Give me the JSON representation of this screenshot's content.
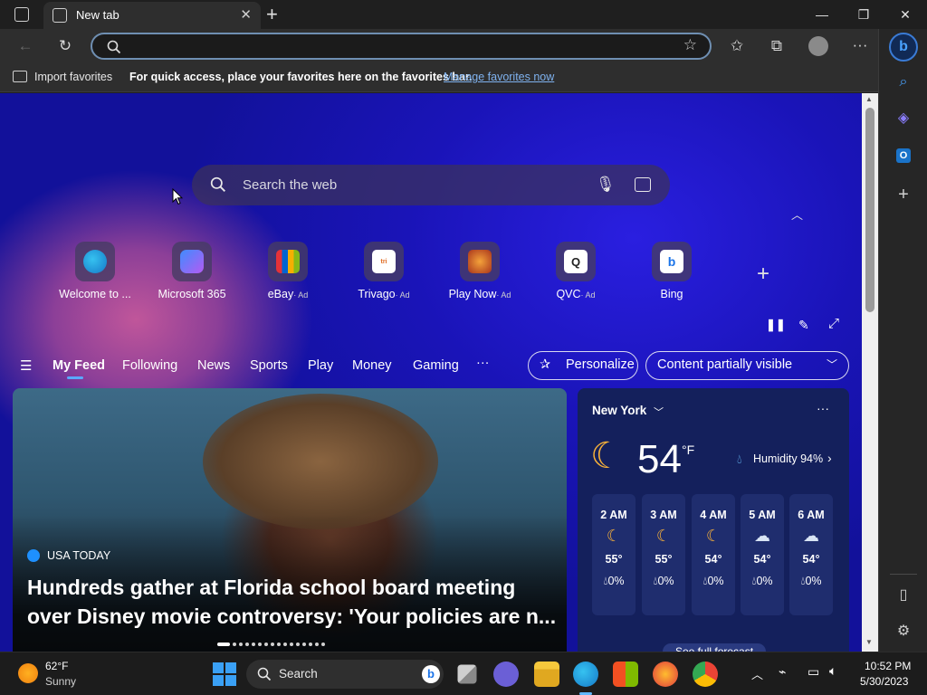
{
  "tab": {
    "title": "New tab"
  },
  "address": {
    "value": ""
  },
  "favorites_bar": {
    "import_label": "Import favorites",
    "message": "For quick access, place your favorites here on the favorites bar.",
    "manage_link": "Manage favorites now"
  },
  "search": {
    "placeholder": "Search the web"
  },
  "quick_links": [
    {
      "label": "Welcome to ...",
      "ad": ""
    },
    {
      "label": "Microsoft 365",
      "ad": ""
    },
    {
      "label": "eBay",
      "ad": "· Ad"
    },
    {
      "label": "Trivago",
      "ad": "· Ad"
    },
    {
      "label": "Play Now",
      "ad": "· Ad"
    },
    {
      "label": "QVC",
      "ad": "· Ad"
    },
    {
      "label": "Bing",
      "ad": ""
    }
  ],
  "feed_nav": {
    "tabs": [
      "My Feed",
      "Following",
      "News",
      "Sports",
      "Play",
      "Money",
      "Gaming"
    ],
    "more": "···",
    "personalize": "Personalize",
    "visibility": "Content partially visible"
  },
  "hero": {
    "source": "USA TODAY",
    "headline": "Hundreds gather at Florida school board meeting over Disney movie controversy: 'Your policies are n..."
  },
  "weather": {
    "city": "New York",
    "temp": "54",
    "unit": "°F",
    "humidity": "Humidity 94%",
    "hours": [
      {
        "time": "2 AM",
        "temp": "55°",
        "precip": "0%"
      },
      {
        "time": "3 AM",
        "temp": "55°",
        "precip": "0%"
      },
      {
        "time": "4 AM",
        "temp": "54°",
        "precip": "0%"
      },
      {
        "time": "5 AM",
        "temp": "54°",
        "precip": "0%"
      },
      {
        "time": "6 AM",
        "temp": "54°",
        "precip": "0%"
      }
    ],
    "forecast_link": "See full forecast"
  },
  "taskbar": {
    "weather_temp": "62°F",
    "weather_desc": "Sunny",
    "search_label": "Search",
    "time": "10:52 PM",
    "date": "5/30/2023"
  }
}
